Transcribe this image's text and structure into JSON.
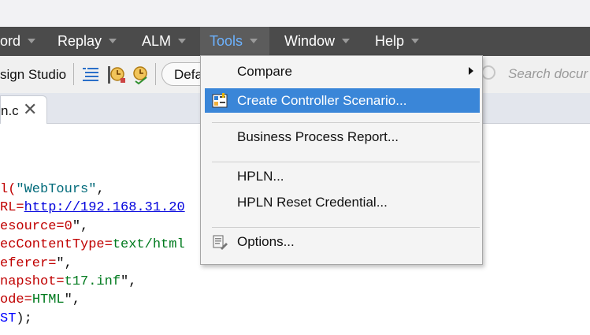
{
  "menubar": {
    "items": [
      {
        "label": "ord"
      },
      {
        "label": "Replay"
      },
      {
        "label": "ALM"
      },
      {
        "label": "Tools"
      },
      {
        "label": "Window"
      },
      {
        "label": "Help"
      }
    ],
    "active": "Tools"
  },
  "toolbar": {
    "design_studio_label": "sign Studio",
    "default_button_label": "Defa",
    "search_placeholder": "Search docur",
    "icons": [
      "list-lines-icon",
      "clock-search-icon",
      "clock-check-icon"
    ]
  },
  "tabs": {
    "doc_tab_label": "n.c",
    "close_glyph": "✕"
  },
  "code": {
    "lines": [
      [
        {
          "t": "l(",
          "c": "k-red"
        },
        {
          "t": "\"WebTours\"",
          "c": "k-str"
        },
        {
          "t": ",",
          "c": ""
        }
      ],
      [
        {
          "t": "RL=",
          "c": "k-red"
        },
        {
          "t": "http://192.168.31.20",
          "c": "k-link"
        }
      ],
      [
        {
          "t": "esource=0",
          "c": "k-red"
        },
        {
          "t": "\",",
          "c": ""
        }
      ],
      [
        {
          "t": "ecContentType=",
          "c": "k-red"
        },
        {
          "t": "text/html",
          "c": "k-green"
        }
      ],
      [
        {
          "t": "eferer=",
          "c": "k-red"
        },
        {
          "t": "\",",
          "c": ""
        }
      ],
      [
        {
          "t": "napshot=",
          "c": "k-red"
        },
        {
          "t": "t17.inf",
          "c": "k-green"
        },
        {
          "t": "\",",
          "c": ""
        }
      ],
      [
        {
          "t": "ode=",
          "c": "k-red"
        },
        {
          "t": "HTML",
          "c": "k-green"
        },
        {
          "t": "\",",
          "c": ""
        }
      ],
      [
        {
          "t": "ST",
          "c": "k-blue"
        },
        {
          "t": ");",
          "c": ""
        }
      ]
    ]
  },
  "tools_menu": {
    "items": {
      "compare": "Compare",
      "create_controller_scenario": "Create Controller Scenario...",
      "business_process_report": "Business Process Report...",
      "hpln": "HPLN...",
      "hpln_reset_credential": "HPLN Reset Credential...",
      "options": "Options..."
    },
    "highlighted": "Create Controller Scenario..."
  },
  "colors": {
    "menubar_bg": "#4b4b4b",
    "active_menu_text": "#6cb2ff",
    "highlight": "#3a86d8"
  }
}
